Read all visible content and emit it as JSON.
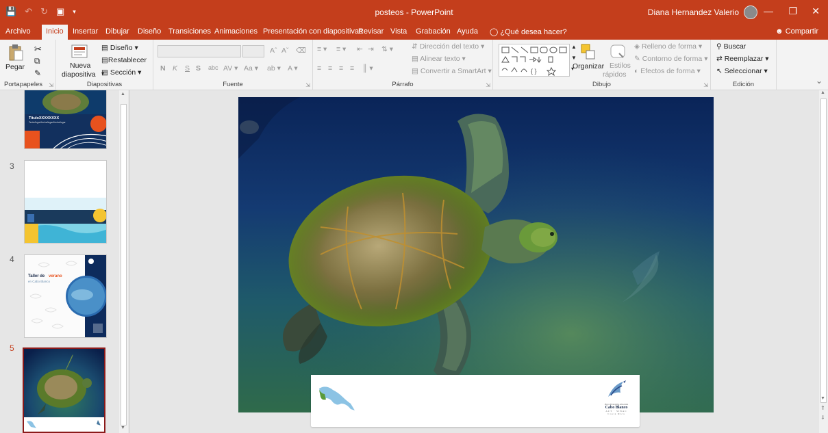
{
  "window": {
    "doc_title": "posteos  -  PowerPoint",
    "user_name": "Diana Hernandez Valerio",
    "icons": {
      "save": "save-icon",
      "undo": "undo-icon",
      "redo": "redo-icon",
      "present": "present-icon"
    }
  },
  "tabs": [
    {
      "label": "Archivo"
    },
    {
      "label": "Inicio"
    },
    {
      "label": "Insertar"
    },
    {
      "label": "Dibujar"
    },
    {
      "label": "Diseño"
    },
    {
      "label": "Transiciones"
    },
    {
      "label": "Animaciones"
    },
    {
      "label": "Presentación con diapositivas"
    },
    {
      "label": "Revisar"
    },
    {
      "label": "Vista"
    },
    {
      "label": "Grabación"
    },
    {
      "label": "Ayuda"
    }
  ],
  "tell_me": "¿Qué desea hacer?",
  "share": "Compartir",
  "ribbon": {
    "clipboard": {
      "label": "Portapapeles",
      "paste": "Pegar"
    },
    "slides": {
      "label": "Diapositivas",
      "new_slide_1": "Nueva",
      "new_slide_2": "diapositiva",
      "layout": "Diseño",
      "reset": "Restablecer",
      "section": "Sección"
    },
    "font": {
      "label": "Fuente",
      "bold": "N",
      "italic": "K",
      "underline": "S",
      "strike": "S",
      "case": "Aa"
    },
    "paragraph": {
      "label": "Párrafo",
      "text_direction": "Dirección del texto",
      "align_text": "Alinear texto",
      "smartart": "Convertir a SmartArt"
    },
    "drawing": {
      "label": "Dibujo",
      "arrange": "Organizar",
      "quick_styles_1": "Estilos",
      "quick_styles_2": "rápidos",
      "shape_fill": "Relleno de forma",
      "shape_outline": "Contorno de forma",
      "shape_effects": "Efectos de forma"
    },
    "editing": {
      "label": "Edición",
      "find": "Buscar",
      "replace": "Reemplazar",
      "select": "Seleccionar"
    }
  },
  "thumbnails": [
    {
      "number": "",
      "title_text": "TituloXXXXXXXX",
      "sub_text": "Texto/lugar/fecha/lugar/fecha/lugar"
    },
    {
      "number": "3"
    },
    {
      "number": "4",
      "title_1": "Taller de",
      "title_accent": "verano",
      "title_2": "en Cabo Blanco"
    },
    {
      "number": "5"
    }
  ],
  "slide": {
    "logo_line1": "Área Protegida Absoluta",
    "logo_line2": "Cabo Blanco",
    "logo_line3": "ACT · SINAC",
    "logo_line4": "Costa Rica"
  },
  "colors": {
    "accent": "#c43e1c",
    "ocean_dark": "#0d2b5c",
    "ocean_green": "#2f6a4a",
    "orange": "#e8521e",
    "yellow": "#f4c430",
    "map_blue": "#8cc3e4"
  }
}
